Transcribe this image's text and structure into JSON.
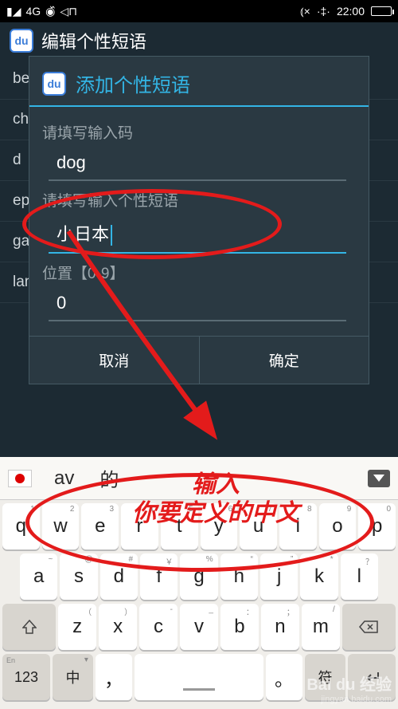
{
  "statusbar": {
    "signal": "4G",
    "time": "22:00"
  },
  "app_header": {
    "title": "编辑个性短语"
  },
  "background_list": {
    "items": [
      "be",
      "ch",
      "d",
      "ep",
      "ga",
      "lambda=λ"
    ]
  },
  "dialog": {
    "title": "添加个性短语",
    "field1_label": "请填写输入码",
    "field1_value": "dog",
    "field2_label": "请填写输入个性短语",
    "field2_value": "小日本",
    "field3_label": "位置【0-9】",
    "field3_value": "0",
    "cancel_label": "取消",
    "confirm_label": "确定"
  },
  "keyboard": {
    "candidates": [
      "av",
      "的"
    ],
    "row1": [
      {
        "main": "q",
        "alt": "1"
      },
      {
        "main": "w",
        "alt": "2"
      },
      {
        "main": "e",
        "alt": "3"
      },
      {
        "main": "r",
        "alt": "4"
      },
      {
        "main": "t",
        "alt": "5"
      },
      {
        "main": "y",
        "alt": "6"
      },
      {
        "main": "u",
        "alt": "7"
      },
      {
        "main": "i",
        "alt": "8"
      },
      {
        "main": "o",
        "alt": "9"
      },
      {
        "main": "p",
        "alt": "0"
      }
    ],
    "row2": [
      {
        "main": "a",
        "alt": "~"
      },
      {
        "main": "s",
        "alt": "@"
      },
      {
        "main": "d",
        "alt": "#"
      },
      {
        "main": "f",
        "alt": "￥"
      },
      {
        "main": "g",
        "alt": "%"
      },
      {
        "main": "h",
        "alt": "“"
      },
      {
        "main": "j",
        "alt": "”"
      },
      {
        "main": "k",
        "alt": "*"
      },
      {
        "main": "l",
        "alt": "？"
      }
    ],
    "row3": [
      {
        "main": "z",
        "alt": "（"
      },
      {
        "main": "x",
        "alt": "）"
      },
      {
        "main": "c",
        "alt": "-"
      },
      {
        "main": "v",
        "alt": "_"
      },
      {
        "main": "b",
        "alt": "："
      },
      {
        "main": "n",
        "alt": "；"
      },
      {
        "main": "m",
        "alt": "/"
      }
    ],
    "bottom": {
      "num_label": "123",
      "num_alt": "En",
      "lang_label": "中",
      "comma": "，",
      "period": "。",
      "symbol_label": "符",
      "enter_label": "↵"
    }
  },
  "annotation": {
    "line1": "输入",
    "line2": "你要定义的中文"
  },
  "watermark": {
    "logo": "Bai du 经验",
    "url": "jingyan.baidu.com"
  }
}
